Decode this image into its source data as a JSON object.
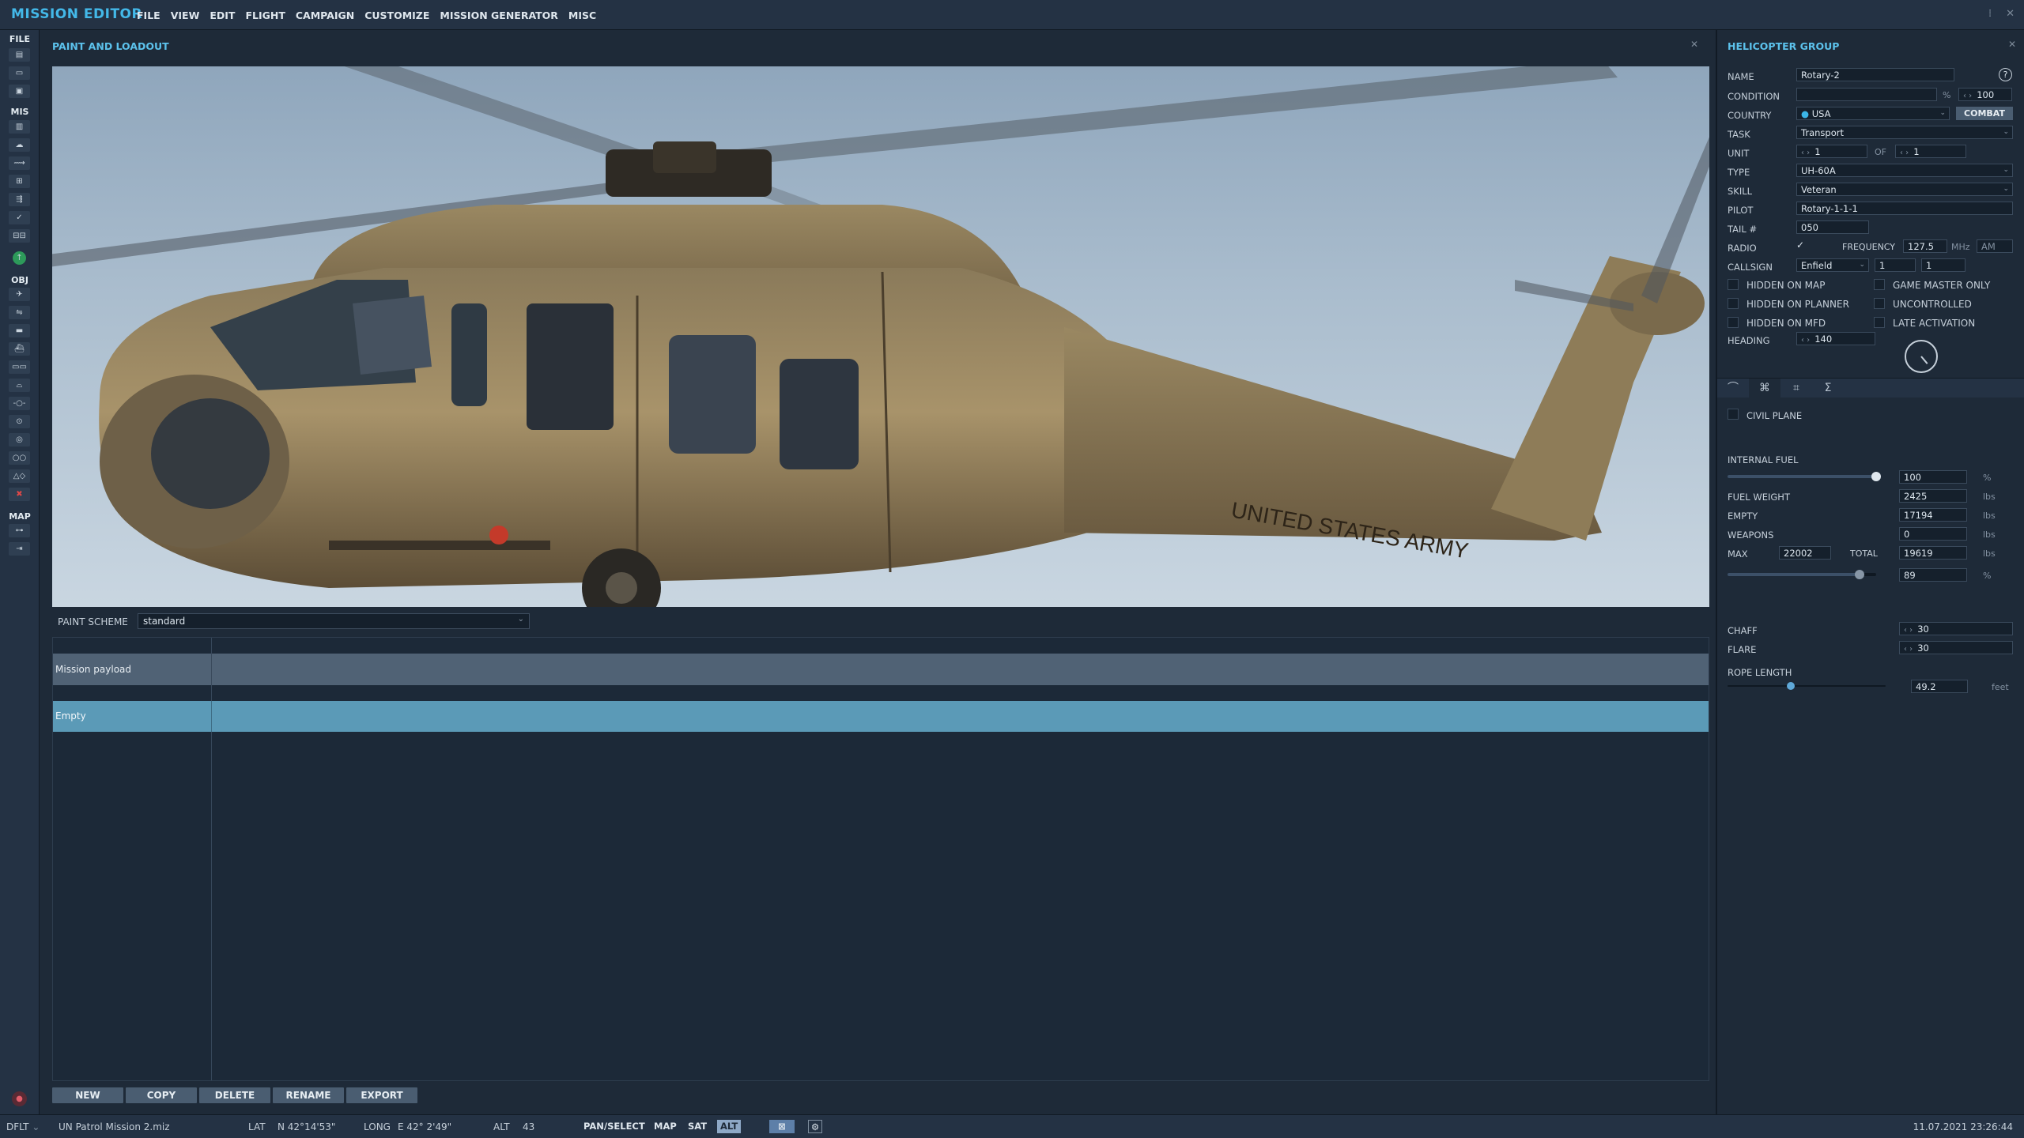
{
  "app": {
    "title": "MISSION EDITOR",
    "menu": [
      "FILE",
      "VIEW",
      "EDIT",
      "FLIGHT",
      "CAMPAIGN",
      "CUSTOMIZE",
      "MISSION GENERATOR",
      "MISC"
    ]
  },
  "lefttoolbar": {
    "sections": {
      "file": "FILE",
      "mis": "MIS",
      "obj": "OBJ",
      "map": "MAP"
    }
  },
  "paint": {
    "title": "PAINT AND LOADOUT",
    "scheme_label": "PAINT SCHEME",
    "scheme_value": "standard",
    "payload_header": "Mission payload",
    "payload_row": "Empty",
    "buttons": {
      "new": "NEW",
      "copy": "COPY",
      "delete": "DELETE",
      "rename": "RENAME",
      "export": "EXPORT"
    },
    "fuselage_text": "UNITED STATES ARMY"
  },
  "group": {
    "title": "HELICOPTER GROUP",
    "name_label": "NAME",
    "name_value": "Rotary-2",
    "help": "?",
    "condition_label": "CONDITION",
    "condition_pct": "%",
    "condition_value": "100",
    "country_label": "COUNTRY",
    "country_value": "USA",
    "combat": "COMBAT",
    "task_label": "TASK",
    "task_value": "Transport",
    "unit_label": "UNIT",
    "unit_value": "1",
    "unit_of": "OF",
    "unit_total": "1",
    "type_label": "TYPE",
    "type_value": "UH-60A",
    "skill_label": "SKILL",
    "skill_value": "Veteran",
    "pilot_label": "PILOT",
    "pilot_value": "Rotary-1-1-1",
    "tail_label": "TAIL #",
    "tail_value": "050",
    "radio_label": "RADIO",
    "freq_label": "FREQUENCY",
    "freq_value": "127.5",
    "freq_unit": "MHz",
    "modulation": "AM",
    "callsign_label": "CALLSIGN",
    "callsign_value": "Enfield",
    "callsign_num1": "1",
    "callsign_num2": "1",
    "hidden_map": "HIDDEN ON MAP",
    "game_master": "GAME MASTER ONLY",
    "hidden_planner": "HIDDEN ON PLANNER",
    "uncontrolled": "UNCONTROLLED",
    "hidden_mfd": "HIDDEN ON MFD",
    "late_activation": "LATE ACTIVATION",
    "heading_label": "HEADING",
    "heading_value": "140"
  },
  "loadout": {
    "civil_plane": "CIVIL PLANE",
    "internal_fuel_label": "INTERNAL FUEL",
    "internal_fuel_value": "100",
    "internal_fuel_unit": "%",
    "internal_fuel_level": 1.0,
    "fuel_weight_label": "FUEL WEIGHT",
    "fuel_weight_value": "2425",
    "lbs": "lbs",
    "empty_label": "EMPTY",
    "empty_value": "17194",
    "weapons_label": "WEAPONS",
    "weapons_value": "0",
    "max_label": "MAX",
    "max_value": "22002",
    "total_label": "TOTAL",
    "total_value": "19619",
    "load_pct_value": "89",
    "load_pct_unit": "%",
    "load_level": 0.89,
    "chaff_label": "CHAFF",
    "chaff_value": "30",
    "flare_label": "FLARE",
    "flare_value": "30",
    "rope_label": "ROPE LENGTH",
    "rope_value": "49.2",
    "rope_unit": "feet",
    "rope_level": 0.4
  },
  "status": {
    "profile": "DFLT",
    "mission_file": "UN Patrol Mission 2.miz",
    "lat_label": "LAT",
    "lat_value": "N 42°14'53\"",
    "long_label": "LONG",
    "long_value": "E 42° 2'49\"",
    "alt_label": "ALT",
    "alt_value": "43",
    "pan": "PAN/SELECT",
    "map": "MAP",
    "sat": "SAT",
    "alt_btn": "ALT",
    "datetime": "11.07.2021 23:26:44"
  }
}
